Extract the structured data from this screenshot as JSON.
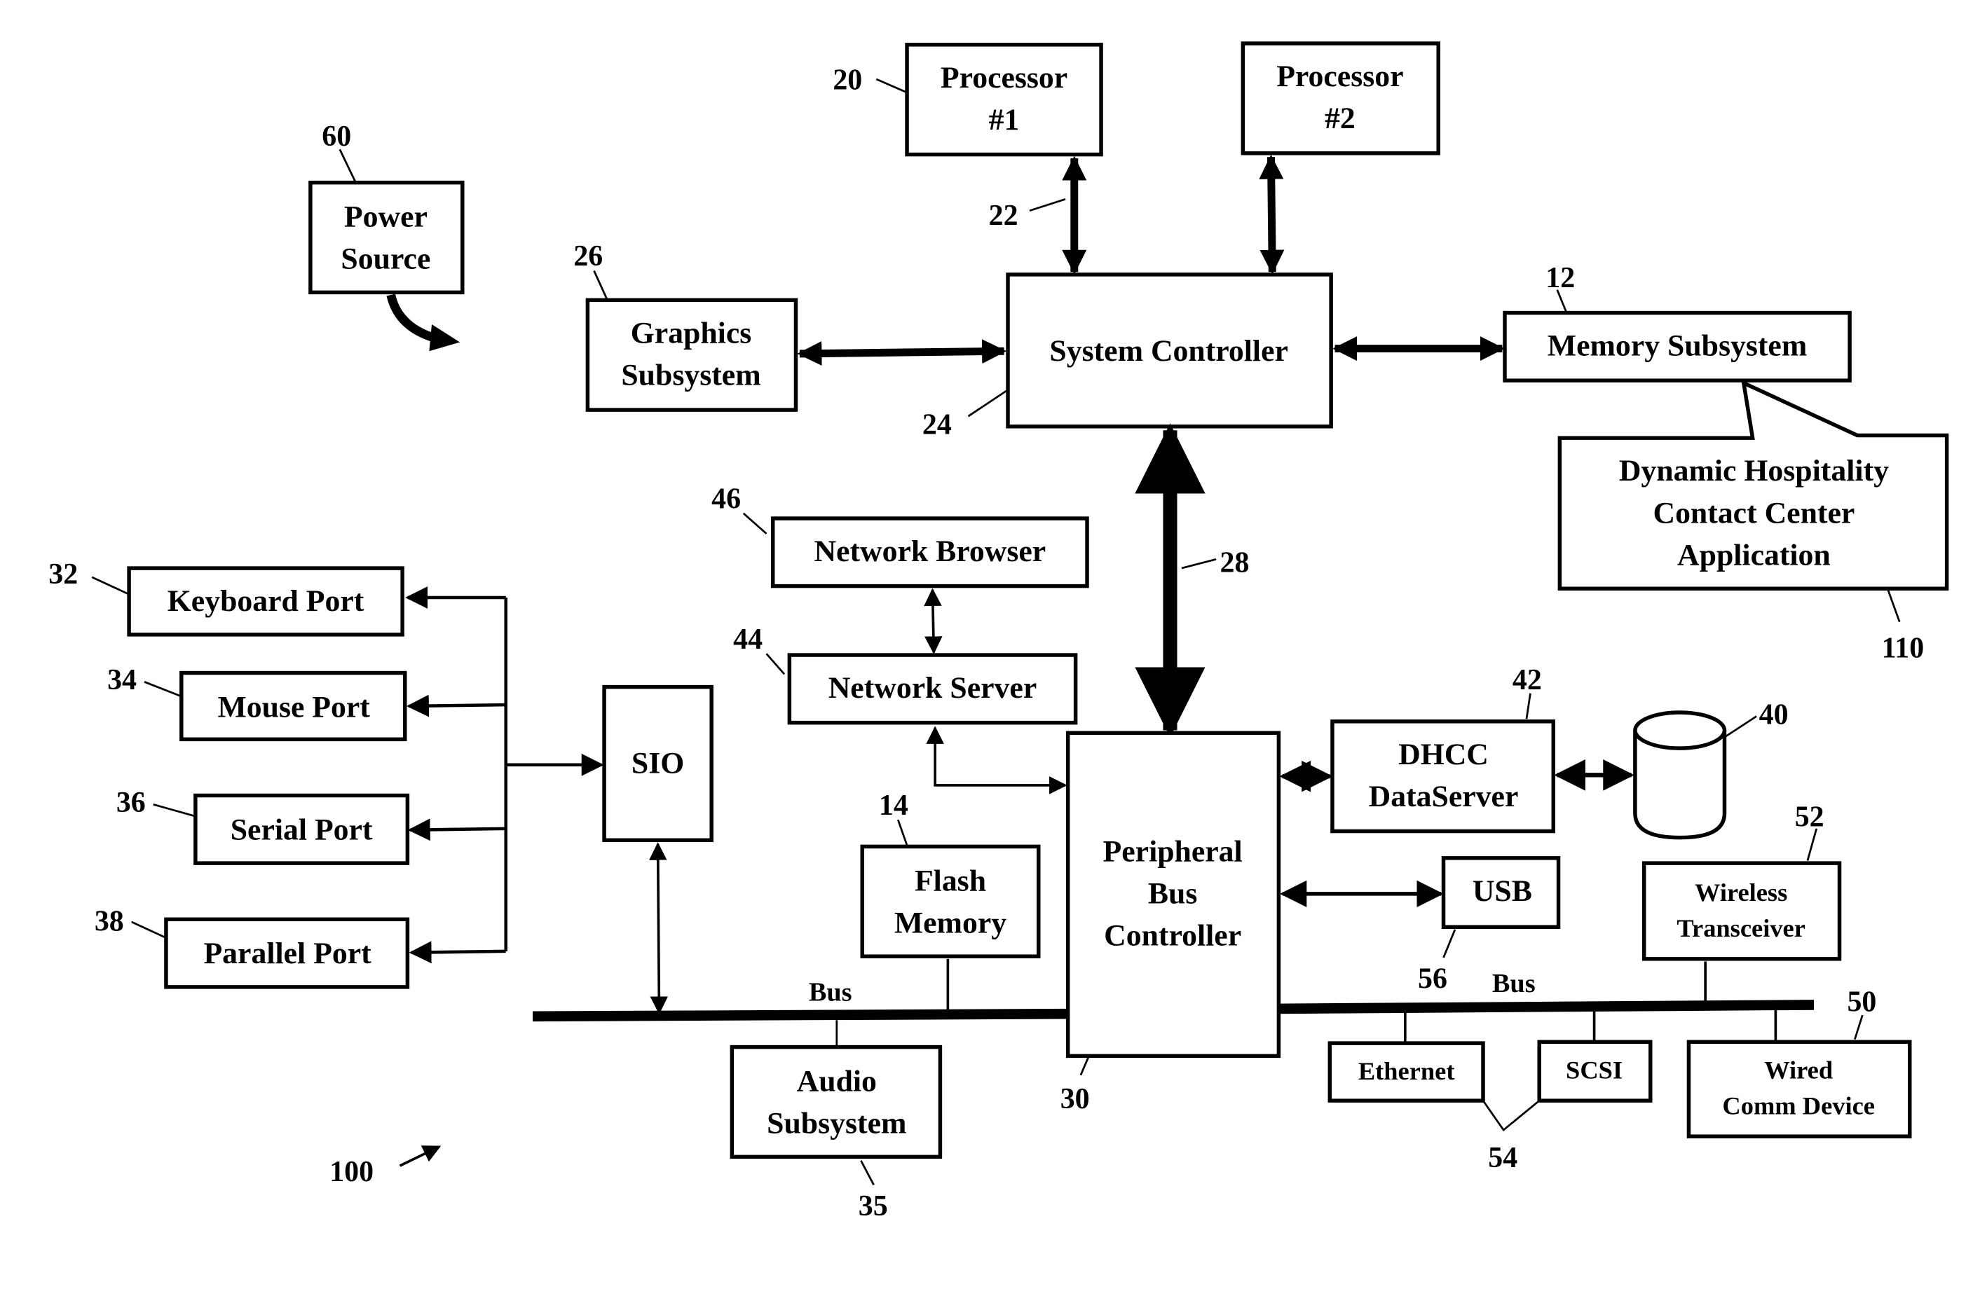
{
  "figure": {
    "figure_ref": "100",
    "blocks": {
      "power_source": {
        "lines": [
          "Power",
          "Source"
        ],
        "ref": "60"
      },
      "processor1": {
        "lines": [
          "Processor",
          "#1"
        ],
        "ref": "20"
      },
      "processor2": {
        "lines": [
          "Processor",
          "#2"
        ]
      },
      "graphics": {
        "lines": [
          "Graphics",
          "Subsystem"
        ],
        "ref": "26"
      },
      "system_controller": {
        "label": "System Controller",
        "ref": "24"
      },
      "memory_subsystem": {
        "label": "Memory Subsystem",
        "ref": "12"
      },
      "dhcc_app": {
        "lines": [
          "Dynamic Hospitality",
          "Contact Center",
          "Application"
        ],
        "ref": "110"
      },
      "network_browser": {
        "label": "Network Browser",
        "ref": "46"
      },
      "network_server": {
        "label": "Network Server",
        "ref": "44"
      },
      "keyboard_port": {
        "label": "Keyboard Port",
        "ref": "32"
      },
      "mouse_port": {
        "label": "Mouse Port",
        "ref": "34"
      },
      "serial_port": {
        "label": "Serial Port",
        "ref": "36"
      },
      "parallel_port": {
        "label": "Parallel Port",
        "ref": "38"
      },
      "sio": {
        "label": "SIO"
      },
      "flash_memory": {
        "lines": [
          "Flash",
          "Memory"
        ],
        "ref": "14"
      },
      "peripheral_bus_controller": {
        "lines": [
          "Peripheral",
          "Bus",
          "Controller"
        ],
        "ref": "30"
      },
      "dhcc_dataserver": {
        "lines": [
          "DHCC",
          "DataServer"
        ],
        "ref": "42"
      },
      "database": {
        "ref": "40"
      },
      "usb": {
        "label": "USB",
        "ref": "56"
      },
      "wireless_transceiver": {
        "lines": [
          "Wireless",
          "Transceiver"
        ],
        "ref": "52"
      },
      "audio_subsystem": {
        "lines": [
          "Audio",
          "Subsystem"
        ],
        "ref": "35"
      },
      "ethernet": {
        "label": "Ethernet"
      },
      "scsi": {
        "label": "SCSI"
      },
      "ethernet_scsi_group": {
        "ref": "54"
      },
      "wired_comm": {
        "lines": [
          "Wired",
          "Comm Device"
        ],
        "ref": "50"
      }
    },
    "connections": {
      "processor_bus_ref": "22",
      "main_bus_ref": "28",
      "left_bus_label": "Bus",
      "right_bus_label": "Bus"
    }
  }
}
